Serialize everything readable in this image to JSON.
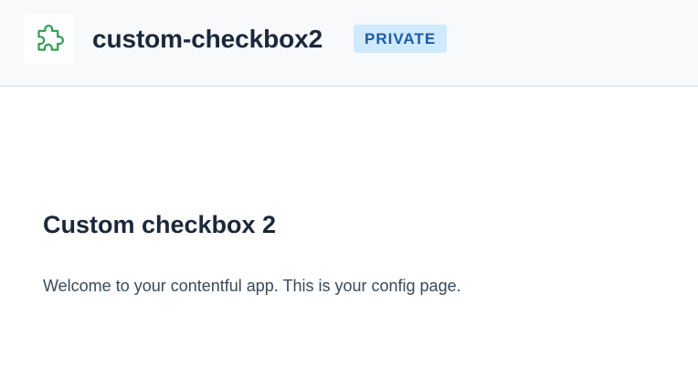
{
  "header": {
    "app_icon": "puzzle-piece-icon",
    "app_name": "custom-checkbox2",
    "badge": "PRIVATE"
  },
  "colors": {
    "header_background": "#f7f9fa",
    "icon_stroke": "#2e9e56",
    "badge_background": "#cfe9fd",
    "badge_text": "#1e5ba5",
    "heading_text": "#1b273a"
  },
  "main": {
    "title": "Custom checkbox 2",
    "body": "Welcome to your contentful app. This is your config page."
  }
}
